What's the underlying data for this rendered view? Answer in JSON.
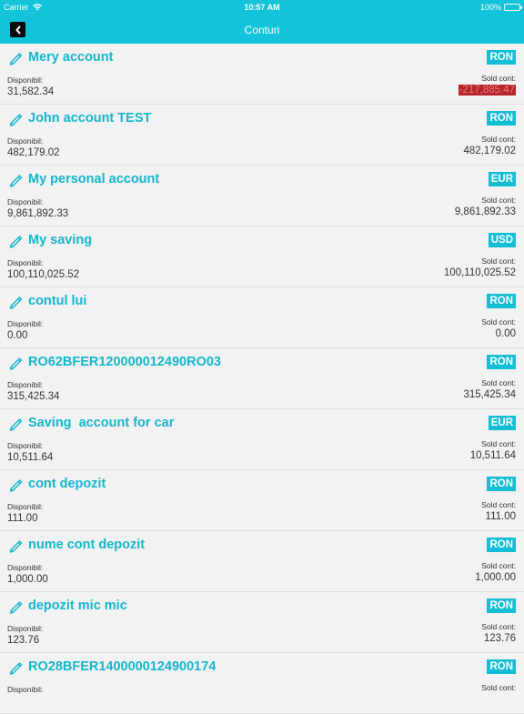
{
  "status_bar": {
    "carrier": "Carrier",
    "time": "10:57 AM",
    "battery": "100%"
  },
  "header": {
    "title": "Conturi",
    "back_glyph": "‹"
  },
  "labels": {
    "available": "Disponibil:",
    "balance": "Sold cont:"
  },
  "accounts": [
    {
      "name": "Mery account",
      "currency": "RON",
      "available": "31,582.34",
      "balance": "-217,885.47",
      "negative": true
    },
    {
      "name": "John account TEST",
      "currency": "RON",
      "available": "482,179.02",
      "balance": "482,179.02",
      "negative": false
    },
    {
      "name": "My personal account",
      "currency": "EUR",
      "available": "9,861,892.33",
      "balance": "9,861,892.33",
      "negative": false
    },
    {
      "name": "My saving",
      "currency": "USD",
      "available": "100,110,025.52",
      "balance": "100,110,025.52",
      "negative": false
    },
    {
      "name": "contul lui",
      "currency": "RON",
      "available": "0.00",
      "balance": "0.00",
      "negative": false
    },
    {
      "name": "RO62BFER120000012490RO03",
      "currency": "RON",
      "available": "315,425.34",
      "balance": "315,425.34",
      "negative": false
    },
    {
      "name": "Saving  account for car",
      "currency": "EUR",
      "available": "10,511.64",
      "balance": "10,511.64",
      "negative": false
    },
    {
      "name": "cont depozit",
      "currency": "RON",
      "available": "111.00",
      "balance": "111.00",
      "negative": false
    },
    {
      "name": "nume cont depozit",
      "currency": "RON",
      "available": "1,000.00",
      "balance": "1,000.00",
      "negative": false
    },
    {
      "name": "depozit mic mic",
      "currency": "RON",
      "available": "123.76",
      "balance": "123.76",
      "negative": false
    },
    {
      "name": "RO28BFER1400000124900174",
      "currency": "RON",
      "available": "",
      "balance": "",
      "negative": false
    }
  ],
  "colors": {
    "accent": "#12c3d9",
    "negative_bg": "#b8262a"
  },
  "icons": {
    "edit": "pencil-icon",
    "back": "chevron-left-icon",
    "wifi": "wifi-icon",
    "battery": "battery-icon"
  }
}
